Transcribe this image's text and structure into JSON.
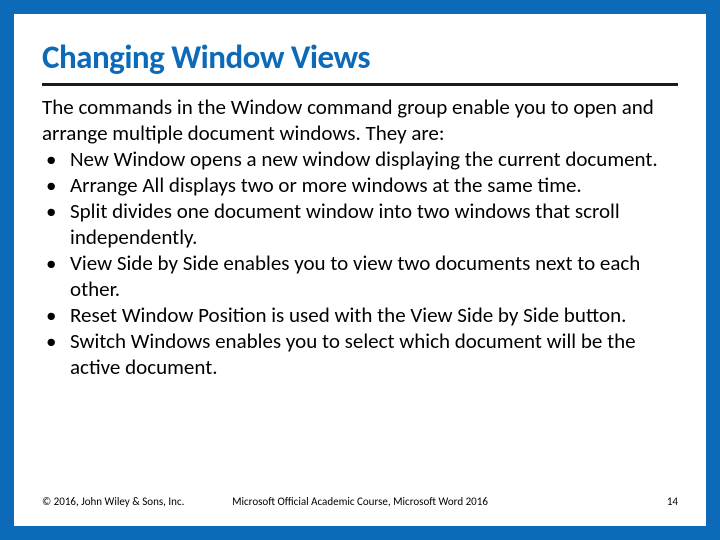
{
  "title": "Changing Window Views",
  "intro": "The commands in the Window command group enable you to open and arrange multiple document windows. They are:",
  "bullets": [
    "New Window opens a new window displaying the current document.",
    "Arrange All displays two or more windows at the same time.",
    "Split divides one document window into two windows that scroll independently.",
    "View Side by Side enables you to view two documents next to each other.",
    "Reset Window Position is used with the View Side by Side button.",
    "Switch Windows enables you to select which document will be the active document."
  ],
  "footer": {
    "left": "© 2016, John Wiley & Sons, Inc.",
    "center": "Microsoft Official Academic Course, Microsoft Word 2016",
    "right": "14"
  }
}
